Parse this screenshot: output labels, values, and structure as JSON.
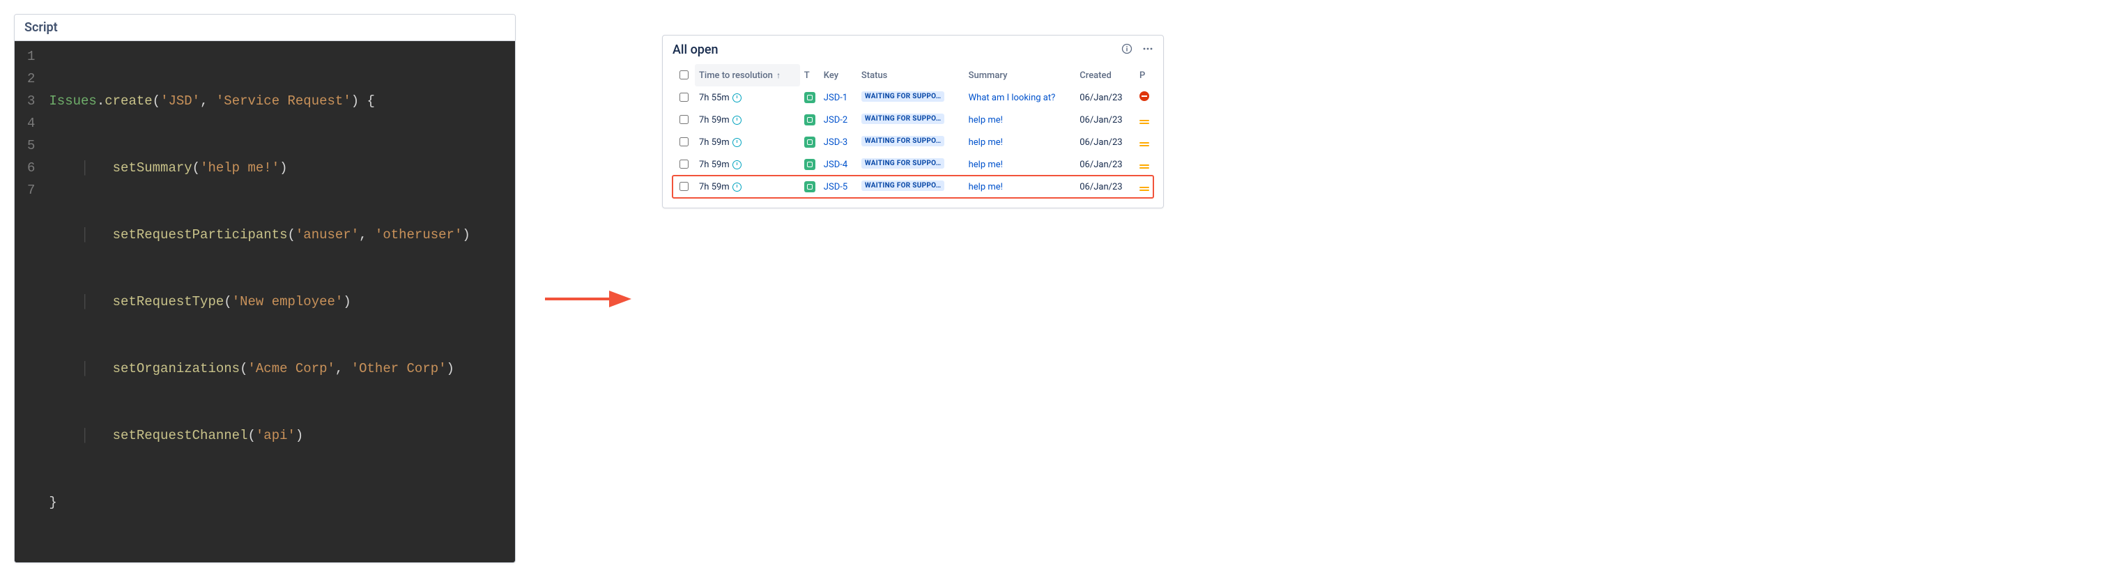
{
  "editor": {
    "header": "Script",
    "line_numbers": [
      "1",
      "2",
      "3",
      "4",
      "5",
      "6",
      "7"
    ],
    "code": {
      "l1_type": "Issues",
      "l1_dot": ".",
      "l1_method": "create",
      "l1_open": "(",
      "l1_arg1": "'JSD'",
      "l1_comma": ", ",
      "l1_arg2": "'Service Request'",
      "l1_close": ") {",
      "l2_method": "setSummary",
      "l2_open": "(",
      "l2_arg1": "'help me!'",
      "l2_close": ")",
      "l3_method": "setRequestParticipants",
      "l3_open": "(",
      "l3_arg1": "'anuser'",
      "l3_comma": ", ",
      "l3_arg2": "'otheruser'",
      "l3_close": ")",
      "l4_method": "setRequestType",
      "l4_open": "(",
      "l4_arg1": "'New employee'",
      "l4_close": ")",
      "l5_method": "setOrganizations",
      "l5_open": "(",
      "l5_arg1": "'Acme Corp'",
      "l5_comma": ", ",
      "l5_arg2": "'Other Corp'",
      "l5_close": ")",
      "l6_method": "setRequestChannel",
      "l6_open": "(",
      "l6_arg1": "'api'",
      "l6_close": ")",
      "l7_close": "}"
    }
  },
  "queue": {
    "title": "All open",
    "columns": {
      "sla": "Time to resolution",
      "t": "T",
      "key": "Key",
      "status": "Status",
      "summary": "Summary",
      "created": "Created",
      "p": "P"
    },
    "status_label": "WAITING FOR SUPPO…",
    "rows": [
      {
        "sla": "7h 55m",
        "key": "JSD-1",
        "summary": "What am I looking at?",
        "created": "06/Jan/23",
        "priority": "blocker"
      },
      {
        "sla": "7h 59m",
        "key": "JSD-2",
        "summary": "help me!",
        "created": "06/Jan/23",
        "priority": "medium"
      },
      {
        "sla": "7h 59m",
        "key": "JSD-3",
        "summary": "help me!",
        "created": "06/Jan/23",
        "priority": "medium"
      },
      {
        "sla": "7h 59m",
        "key": "JSD-4",
        "summary": "help me!",
        "created": "06/Jan/23",
        "priority": "medium"
      },
      {
        "sla": "7h 59m",
        "key": "JSD-5",
        "summary": "help me!",
        "created": "06/Jan/23",
        "priority": "medium"
      }
    ]
  }
}
